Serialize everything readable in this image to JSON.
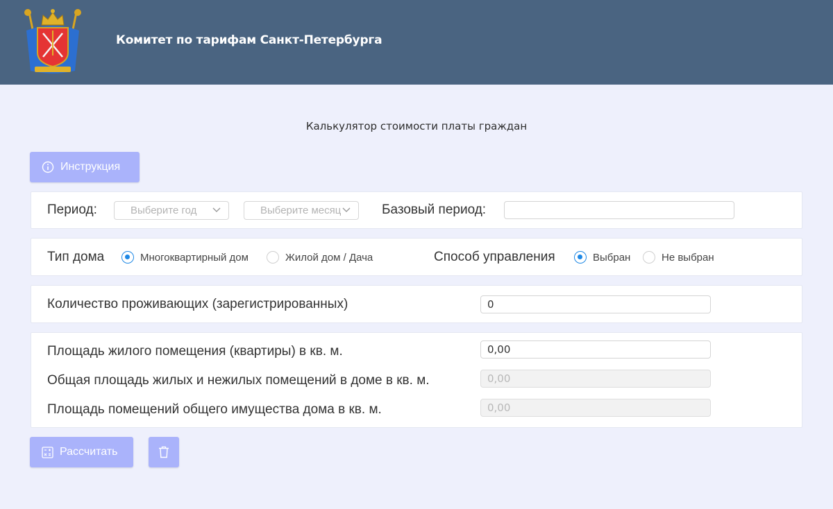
{
  "header": {
    "title": "Комитет по тарифам Санкт-Петербурга",
    "logo_icon": "coat-of-arms-icon",
    "background": "#4a6481"
  },
  "page": {
    "heading": "Калькулятор стоимости платы граждан"
  },
  "buttons": {
    "instruction_label": "Инструкция",
    "calculate_label": "Рассчитать",
    "button_color": "#aab3fb"
  },
  "period": {
    "label": "Период:",
    "year_placeholder": "Выберите год",
    "month_placeholder": "Выберите месяц",
    "base_label": "Базовый период:",
    "base_value": ""
  },
  "house_type": {
    "label": "Тип дома",
    "options": [
      {
        "label": "Многоквартирный дом",
        "selected": true
      },
      {
        "label": "Жилой дом / Дача",
        "selected": false
      }
    ]
  },
  "management": {
    "label": "Способ управления",
    "options": [
      {
        "label": "Выбран",
        "selected": true
      },
      {
        "label": "Не выбран",
        "selected": false
      }
    ]
  },
  "residents": {
    "label": "Количество проживающих (зарегистрированных)",
    "value": "0"
  },
  "area": {
    "living_label": "Площадь жилого помещения (квартиры) в кв. м.",
    "living_value": "0,00",
    "total_label": "Общая площадь жилых и нежилых помещений в доме в кв. м.",
    "total_value": "0,00",
    "common_label": "Площадь помещений общего имущества дома в кв. м.",
    "common_value": "0,00"
  },
  "accent_color": "#1e88e5"
}
